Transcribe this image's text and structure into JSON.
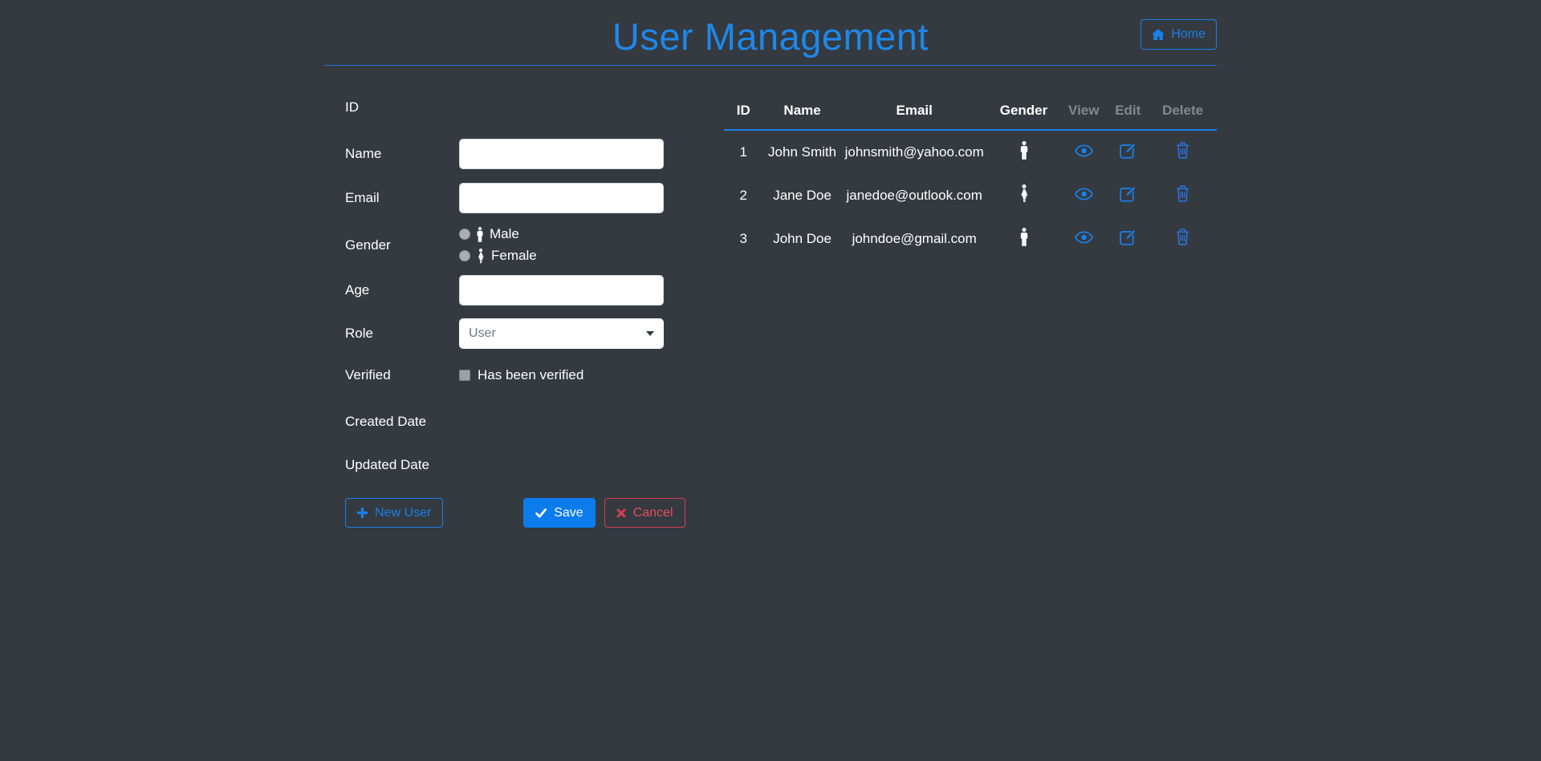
{
  "page": {
    "title": "User Management"
  },
  "colors": {
    "background": "#343a40",
    "accent": "#1e87e8",
    "primary_button": "#0c7cec",
    "danger": "#d43f51",
    "muted_header": "#82898f"
  },
  "header": {
    "home_label": "Home"
  },
  "form": {
    "id": {
      "label": "ID",
      "value": ""
    },
    "name": {
      "label": "Name",
      "value": ""
    },
    "email": {
      "label": "Email",
      "value": ""
    },
    "gender": {
      "label": "Gender",
      "male_label": "Male",
      "female_label": "Female",
      "selected": ""
    },
    "age": {
      "label": "Age",
      "value": ""
    },
    "role": {
      "label": "Role",
      "value": "User"
    },
    "verified": {
      "label": "Verified",
      "checkbox_label": "Has been verified",
      "checked": false
    },
    "created_date": {
      "label": "Created Date",
      "value": ""
    },
    "updated_date": {
      "label": "Updated Date",
      "value": ""
    }
  },
  "actions": {
    "new_user": "New User",
    "save": "Save",
    "cancel": "Cancel"
  },
  "table": {
    "headers": [
      "ID",
      "Name",
      "Email",
      "Gender",
      "View",
      "Edit",
      "Delete"
    ],
    "rows": [
      {
        "id": "1",
        "name": "John Smith",
        "email": "johnsmith@yahoo.com",
        "gender": "male"
      },
      {
        "id": "2",
        "name": "Jane Doe",
        "email": "janedoe@outlook.com",
        "gender": "female"
      },
      {
        "id": "3",
        "name": "John Doe",
        "email": "johndoe@gmail.com",
        "gender": "male"
      }
    ]
  }
}
